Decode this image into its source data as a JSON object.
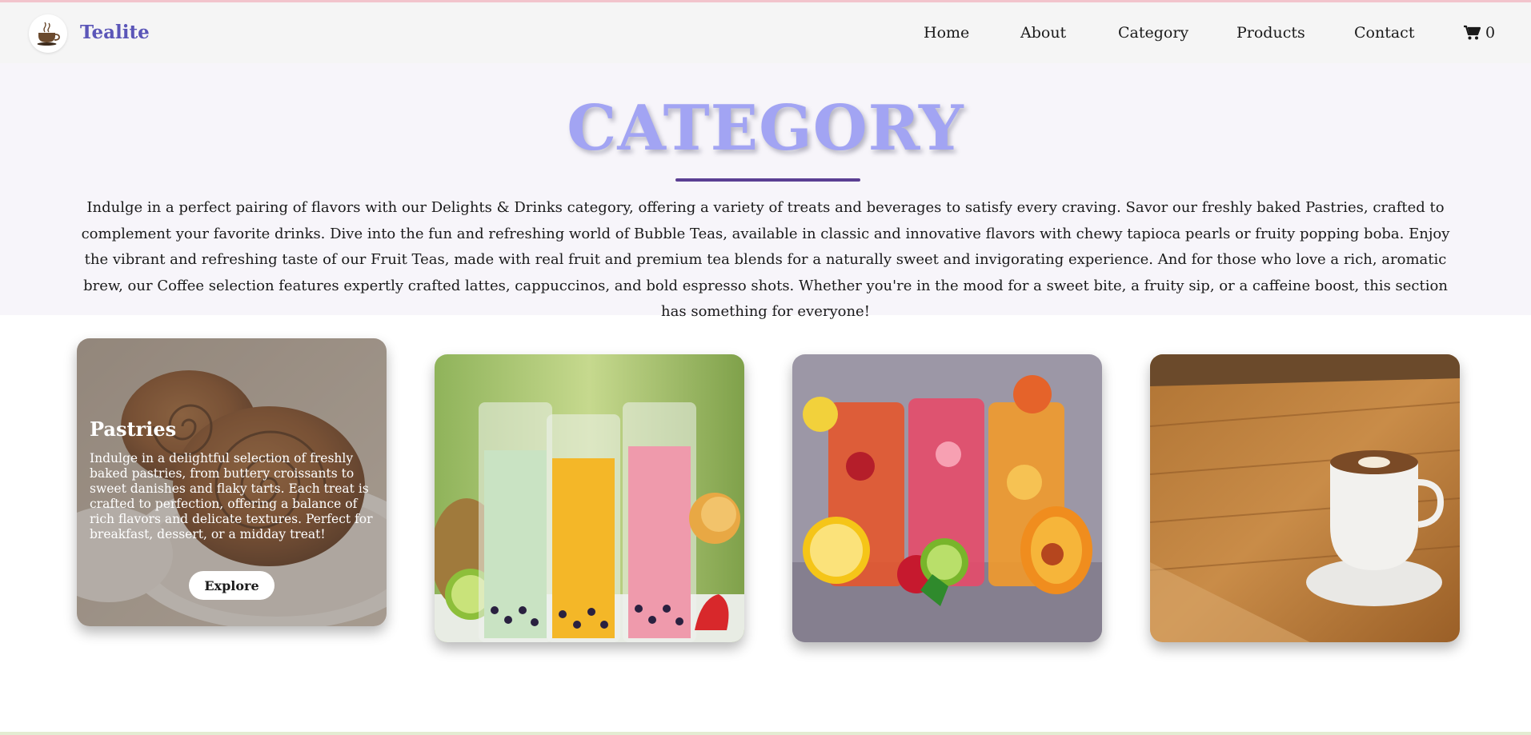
{
  "brand": {
    "name": "Tealite",
    "logo_icon": "tea-cup-icon"
  },
  "nav": {
    "items": [
      "Home",
      "About",
      "Category",
      "Products",
      "Contact"
    ],
    "cart_icon": "cart-icon",
    "cart_count": "0"
  },
  "hero": {
    "title": "CATEGORY",
    "description": "Indulge in a perfect pairing of flavors with our Delights & Drinks category, offering a variety of treats and beverages to satisfy every craving. Savor our freshly baked Pastries, crafted to complement your favorite drinks. Dive into the fun and refreshing world of Bubble Teas, available in classic and innovative flavors with chewy tapioca pearls or fruity popping boba. Enjoy the vibrant and refreshing taste of our Fruit Teas, made with real fruit and premium tea blends for a naturally sweet and invigorating experience. And for those who love a rich, aromatic brew, our Coffee selection features expertly crafted lattes, cappuccinos, and bold espresso shots. Whether you're in the mood for a sweet bite, a fruity sip, or a caffeine boost, this section has something for everyone!"
  },
  "cards": [
    {
      "image": "pastries-photo",
      "title": "Pastries",
      "description": "Indulge in a delightful selection of freshly baked pastries, from buttery croissants to sweet danishes and flaky tarts. Each treat is crafted to perfection, offering a balance of rich flavors and delicate textures. Perfect for breakfast, dessert, or a midday treat!",
      "button": "Explore"
    },
    {
      "image": "bubble-tea-photo"
    },
    {
      "image": "fruit-tea-photo"
    },
    {
      "image": "coffee-photo"
    }
  ],
  "colors": {
    "brand": "#5b56b8",
    "title": "#a2a4f3",
    "underline": "#5b3f93",
    "navbar_bg": "#f5f5f5",
    "hero_bg": "#f7f5fa"
  }
}
